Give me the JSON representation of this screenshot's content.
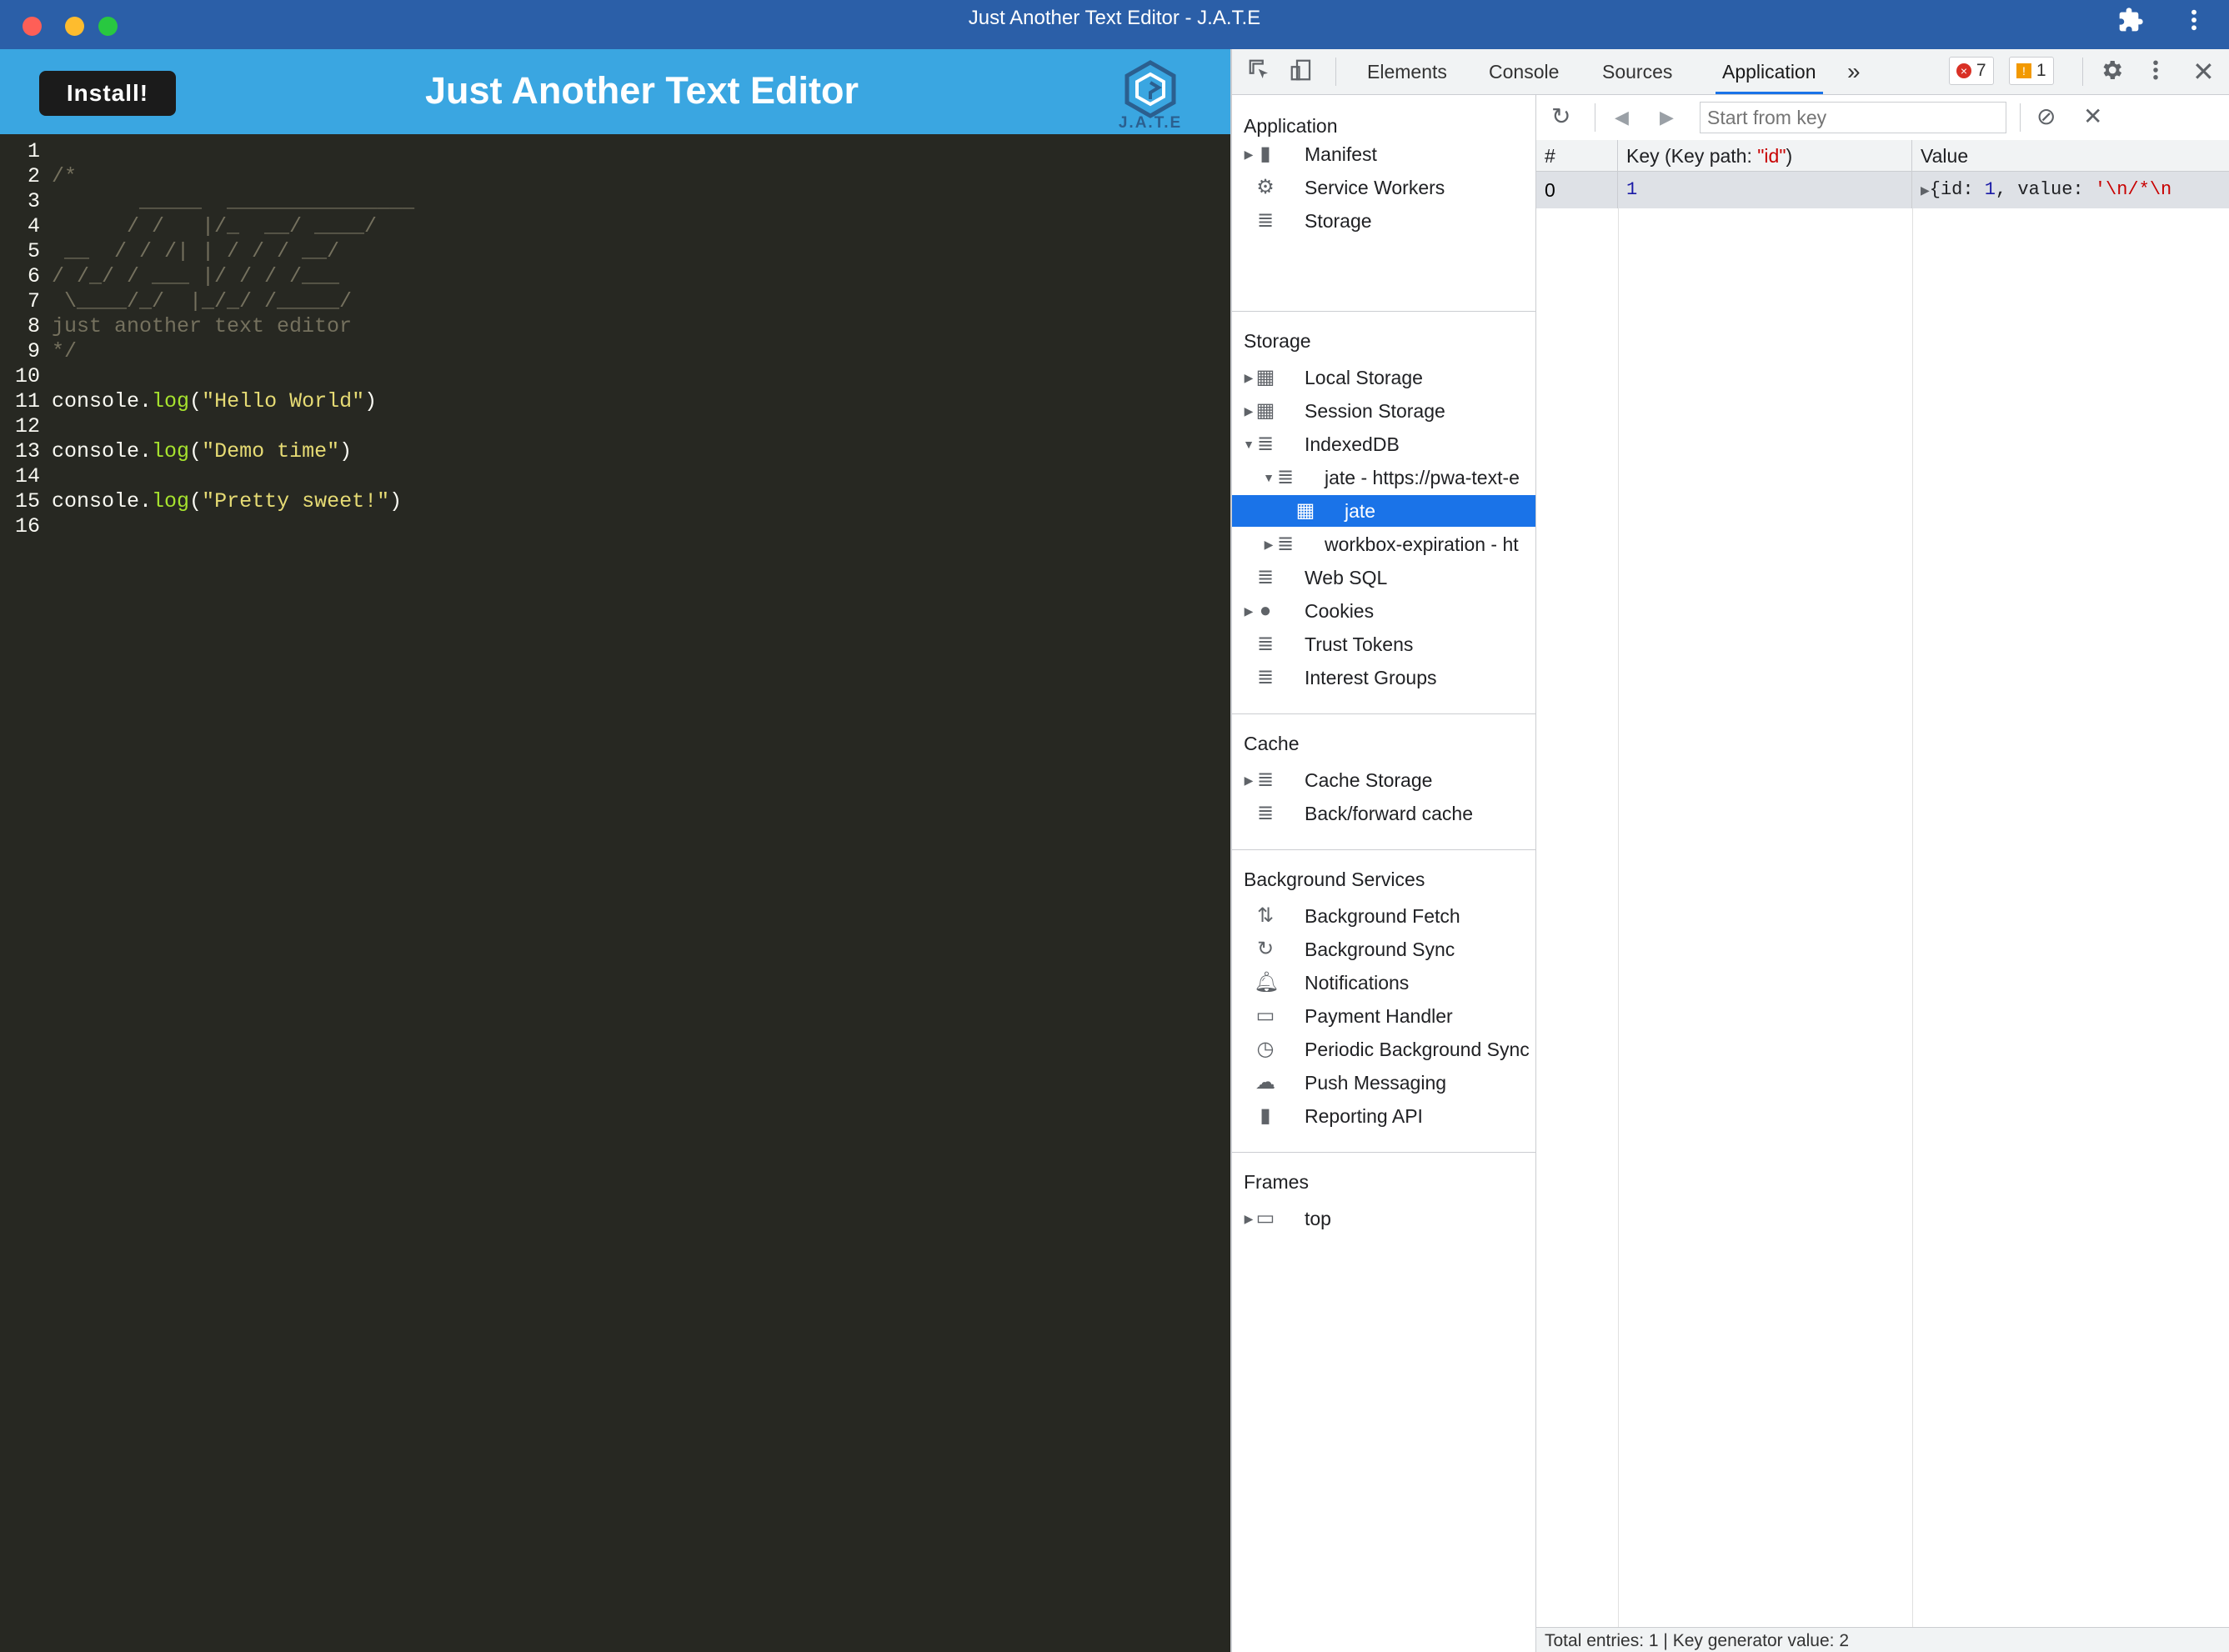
{
  "window": {
    "title": "Just Another Text Editor - J.A.T.E"
  },
  "app": {
    "install_label": "Install!",
    "title": "Just Another Text Editor",
    "logo_text": "J.A.T.E"
  },
  "editor": {
    "lines": [
      {
        "n": "1",
        "t": ""
      },
      {
        "n": "2",
        "t": "/*"
      },
      {
        "n": "3",
        "t": "       _____  _______________"
      },
      {
        "n": "4",
        "t": "      / /   |/_  __/ ____/"
      },
      {
        "n": "5",
        "t": " __  / / /| | / / / __/"
      },
      {
        "n": "6",
        "t": "/ /_/ / ___ |/ / / /___"
      },
      {
        "n": "7",
        "t": " \\____/_/  |_/_/ /_____/"
      },
      {
        "n": "8",
        "t": "just another text editor"
      },
      {
        "n": "9",
        "t": "*/"
      },
      {
        "n": "10",
        "t": ""
      },
      {
        "n": "11",
        "obj": "console.",
        "fn": "log",
        "p1": "(",
        "str": "\"Hello World\"",
        "p2": ")"
      },
      {
        "n": "12",
        "t": ""
      },
      {
        "n": "13",
        "obj": "console.",
        "fn": "log",
        "p1": "(",
        "str": "\"Demo time\"",
        "p2": ")"
      },
      {
        "n": "14",
        "t": ""
      },
      {
        "n": "15",
        "obj": "console.",
        "fn": "log",
        "p1": "(",
        "str": "\"Pretty sweet!\"",
        "p2": ")"
      },
      {
        "n": "16",
        "t": ""
      }
    ]
  },
  "devtools": {
    "tabs": [
      "Elements",
      "Console",
      "Sources",
      "Application"
    ],
    "active_tab": "Application",
    "more": "»",
    "errors": "7",
    "warnings": "1",
    "sidebar": {
      "application_header": "Application",
      "application_items": [
        "Manifest",
        "Service Workers",
        "Storage"
      ],
      "storage_header": "Storage",
      "storage_items": [
        "Local Storage",
        "Session Storage",
        "IndexedDB",
        "jate - https://pwa-text-e",
        "jate",
        "workbox-expiration - ht",
        "Web SQL",
        "Cookies",
        "Trust Tokens",
        "Interest Groups"
      ],
      "cache_header": "Cache",
      "cache_items": [
        "Cache Storage",
        "Back/forward cache"
      ],
      "bg_header": "Background Services",
      "bg_items": [
        "Background Fetch",
        "Background Sync",
        "Notifications",
        "Payment Handler",
        "Periodic Background Sync",
        "Push Messaging",
        "Reporting API"
      ],
      "frames_header": "Frames",
      "frames_items": [
        "top"
      ]
    },
    "idb": {
      "start_placeholder": "Start from key",
      "columns": [
        "#",
        "Key (Key path: ",
        "\"id\"",
        ")",
        "Value"
      ],
      "row_index": "0",
      "row_key": "1",
      "row_value_pre": "{id: ",
      "row_value_id": "1",
      "row_value_mid": ", value: ",
      "row_value_str": "'\\n/*\\n",
      "footer": "Total entries: 1 | Key generator value: 2"
    }
  }
}
